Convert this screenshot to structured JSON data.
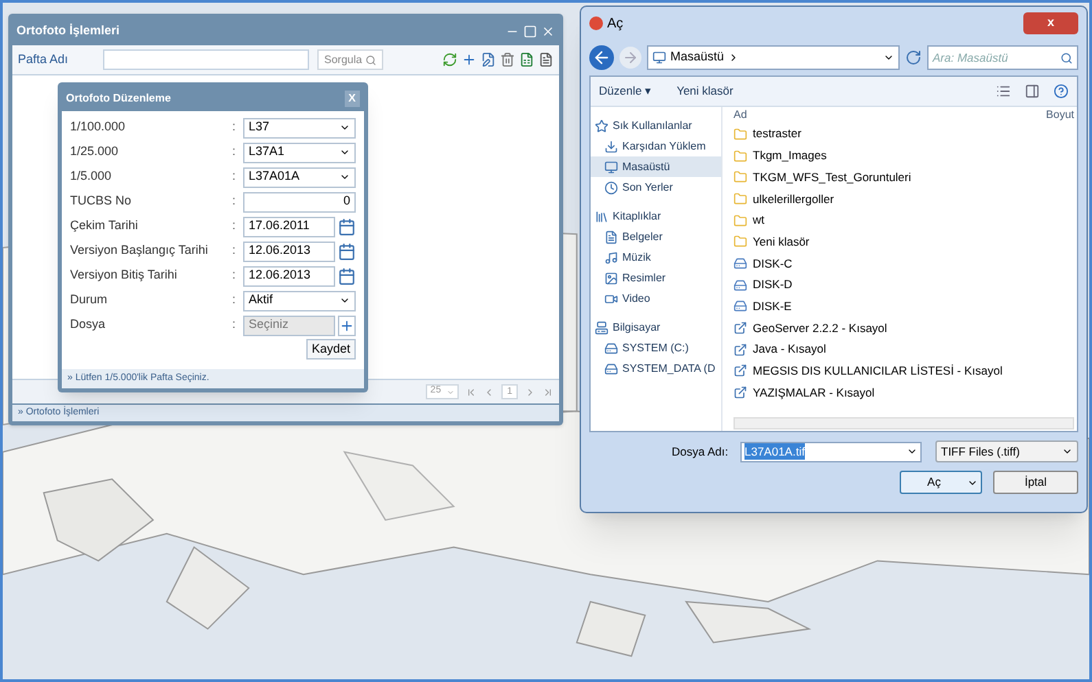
{
  "main_window": {
    "title": "Ortofoto İşlemleri",
    "search_label": "Pafta Adı",
    "search_button": "Sorgula",
    "footer": "» Ortofoto İşlemleri",
    "pager": {
      "page_size": "25",
      "page": "1"
    }
  },
  "edit_dialog": {
    "title": "Ortofoto Düzenleme",
    "close": "X",
    "fields": [
      {
        "label": "1/100.000",
        "separator": ":",
        "value": "L37",
        "kind": "select"
      },
      {
        "label": "1/25.000",
        "separator": ":",
        "value": "L37A1",
        "kind": "select"
      },
      {
        "label": "1/5.000",
        "separator": ":",
        "value": "L37A01A",
        "kind": "select"
      },
      {
        "label": "TUCBS No",
        "separator": ":",
        "value": "0",
        "kind": "number"
      },
      {
        "label": "Çekim Tarihi",
        "separator": ":",
        "value": "17.06.2011",
        "kind": "date"
      },
      {
        "label": "Versiyon Başlangıç Tarihi",
        "separator": ":",
        "value": "12.06.2013",
        "kind": "date"
      },
      {
        "label": "Versiyon Bitiş Tarihi",
        "separator": ":",
        "value": "12.06.2013",
        "kind": "date"
      },
      {
        "label": "Durum",
        "separator": ":",
        "value": "Aktif",
        "kind": "select"
      },
      {
        "label": "Dosya",
        "separator": ":",
        "placeholder": "Seçiniz",
        "kind": "file"
      }
    ],
    "save_button": "Kaydet",
    "hint": "» Lütfen 1/5.000'lik Pafta Seçiniz."
  },
  "file_dialog": {
    "title": "Aç",
    "close": "x",
    "breadcrumb": "Masaüstü",
    "search_placeholder": "Ara: Masaüstü",
    "toolbar": [
      "Düzenle ▾",
      "Yeni klasör"
    ],
    "nav": [
      {
        "label": "Sık Kullanılanlar",
        "selected": false,
        "children": [
          {
            "label": "Karşıdan Yüklem",
            "selected": false
          },
          {
            "label": "Masaüstü",
            "selected": true
          },
          {
            "label": "Son Yerler",
            "selected": false
          }
        ]
      },
      {
        "label": "Kitaplıklar",
        "selected": false,
        "children": [
          {
            "label": "Belgeler",
            "selected": false
          },
          {
            "label": "Müzik",
            "selected": false
          },
          {
            "label": "Resimler",
            "selected": false
          },
          {
            "label": "Video",
            "selected": false
          }
        ]
      },
      {
        "label": "Bilgisayar",
        "selected": false,
        "children": [
          {
            "label": "SYSTEM (C:)",
            "selected": false
          },
          {
            "label": "SYSTEM_DATA (D",
            "selected": false
          }
        ]
      }
    ],
    "columns": [
      "Ad",
      "Boyut"
    ],
    "files": [
      {
        "name": "testraster",
        "kind": "folder"
      },
      {
        "name": "Tkgm_Images",
        "kind": "folder"
      },
      {
        "name": "TKGM_WFS_Test_Goruntuleri",
        "kind": "folder"
      },
      {
        "name": "ulkelerillergoller",
        "kind": "folder"
      },
      {
        "name": "wt",
        "kind": "folder"
      },
      {
        "name": "Yeni klasör",
        "kind": "folder"
      },
      {
        "name": "DISK-C",
        "kind": "drive"
      },
      {
        "name": "DISK-D",
        "kind": "drive"
      },
      {
        "name": "DISK-E",
        "kind": "drive"
      },
      {
        "name": "GeoServer 2.2.2 - Kısayol",
        "kind": "shortcut"
      },
      {
        "name": "Java - Kısayol",
        "kind": "shortcut"
      },
      {
        "name": "MEGSIS DIS KULLANICILAR LİSTESİ - Kısayol",
        "kind": "shortcut"
      },
      {
        "name": "YAZIŞMALAR - Kısayol",
        "kind": "shortcut"
      }
    ],
    "filename_label": "Dosya Adı:",
    "filename": "L37A01A.tif",
    "filetype": "TIFF Files (.tiff)",
    "open_button": "Aç",
    "cancel_button": "İptal"
  }
}
